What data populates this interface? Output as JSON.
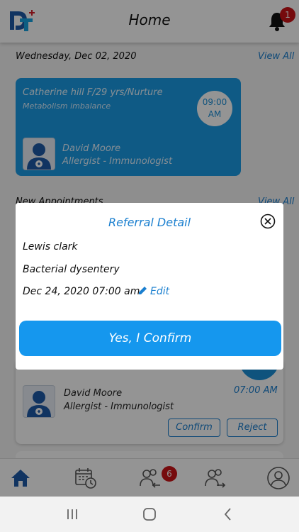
{
  "header": {
    "title": "Home",
    "notification_count": "1"
  },
  "today": {
    "date": "Wednesday, Dec 02, 2020",
    "view_all": "View All",
    "card": {
      "patient": "Catherine hill F/29 yrs/Nurture",
      "condition": "Metabolism imbalance",
      "time_hour": "09:00",
      "time_ampm": "AM",
      "doctor": "David Moore",
      "specialty": "Allergist - Immunologist"
    }
  },
  "new_appointments": {
    "title": "New Appointments",
    "view_all": "View All",
    "card": {
      "doctor": "David Moore",
      "specialty": "Allergist - Immunologist",
      "time": "07:00 AM",
      "confirm_label": "Confirm",
      "reject_label": "Reject"
    }
  },
  "bottom_nav": {
    "items": [
      {
        "icon": "home-icon",
        "active": true
      },
      {
        "icon": "calendar-clock-icon",
        "active": false
      },
      {
        "icon": "referral-users-icon",
        "active": false,
        "badge": "6"
      },
      {
        "icon": "transfer-users-icon",
        "active": false
      },
      {
        "icon": "profile-icon",
        "active": false
      }
    ]
  },
  "modal": {
    "title": "Referral Detail",
    "patient": "Lewis clark",
    "condition": "Bacterial dysentery",
    "datetime": "Dec 24, 2020 07:00 am",
    "edit_label": "Edit",
    "confirm_label": "Yes, I Confirm"
  },
  "colors": {
    "accent": "#1b9be6",
    "badge": "#cc1418",
    "link": "#1a7fcf"
  }
}
